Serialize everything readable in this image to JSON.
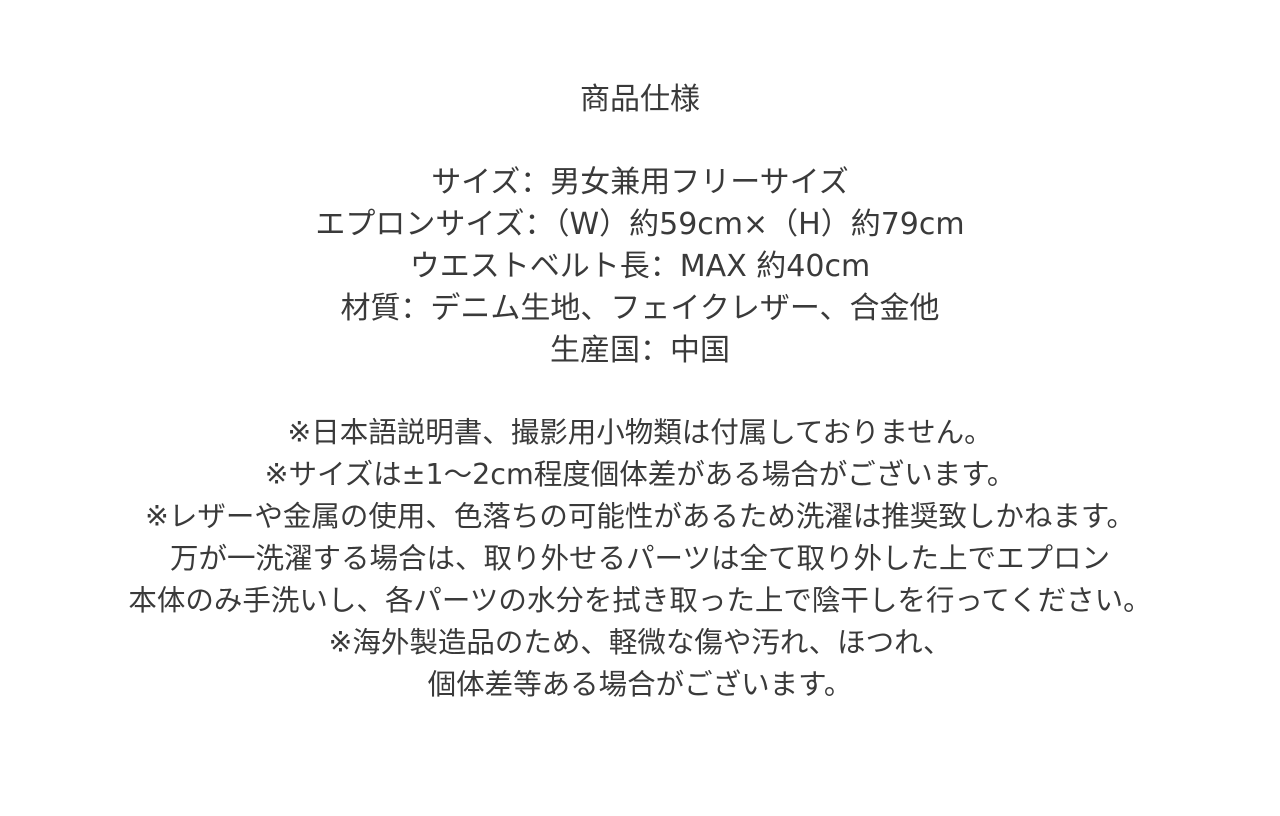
{
  "title": "商品仕様",
  "spec_lines": [
    "サイズ：男女兼用フリーサイズ",
    "エプロンサイズ：（W）約59cm×（H）約79cm",
    "ウエストベルト長：MAX 約40cm",
    "材質：デニム生地、フェイクレザー、合金他",
    "生産国：中国"
  ],
  "note_lines": [
    "※日本語説明書、撮影用小物類は付属しておりません。",
    "※サイズは±1〜2cm程度個体差がある場合がございます。",
    "※レザーや金属の使用、色落ちの可能性があるため洗濯は推奨致しかねます。",
    "万が一洗濯する場合は、取り外せるパーツは全て取り外した上でエプロン",
    "本体のみ手洗いし、各パーツの水分を拭き取った上で陰干しを行ってください。",
    "※海外製造品のため、軽微な傷や汚れ、ほつれ、",
    "個体差等ある場合がございます。"
  ]
}
